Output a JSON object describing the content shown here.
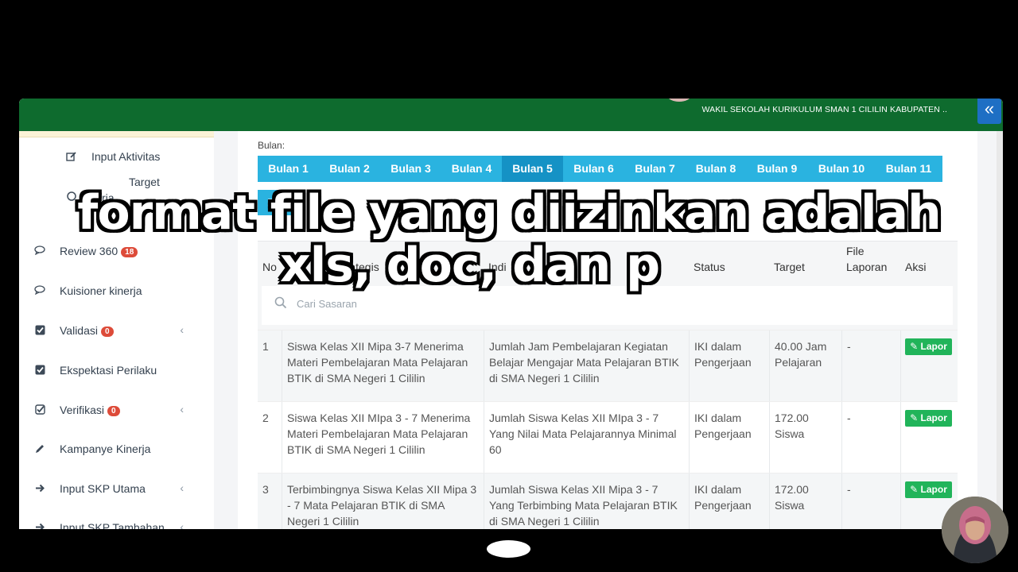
{
  "header": {
    "user": "WAKIL SEKOLAH KURIKULUM SMAN 1 CILILIN KABUPATEN ..",
    "collapse_icon": "double-chevron-left-icon"
  },
  "sidebar": {
    "items": [
      {
        "label": "Input Aktivitas",
        "icon": "edit-icon",
        "sub": true
      },
      {
        "label": "Target Kinerja",
        "icon": "circle-icon",
        "sub": true
      },
      {
        "label": "Review 360",
        "icon": "comment-icon",
        "badge": "18"
      },
      {
        "label": "Kuisioner kinerja",
        "icon": "comment-icon"
      },
      {
        "label": "Validasi",
        "icon": "check-square-icon",
        "badge": "0",
        "caret": true
      },
      {
        "label": "Ekspektasi Perilaku",
        "icon": "check-square-icon"
      },
      {
        "label": "Verifikasi",
        "icon": "check-square-outline-icon",
        "badge": "0",
        "caret": true
      },
      {
        "label": "Kampanye Kinerja",
        "icon": "pencil-icon"
      },
      {
        "label": "Input SKP Utama",
        "icon": "arrow-right-icon",
        "caret": true
      },
      {
        "label": "Input SKP Tambahan",
        "icon": "arrow-right-icon",
        "caret": true
      }
    ]
  },
  "content": {
    "month_label": "Bulan:",
    "tabs": [
      "Bulan 1",
      "Bulan 2",
      "Bulan 3",
      "Bulan 4",
      "Bulan 5",
      "Bulan 6",
      "Bulan 7",
      "Bulan 8",
      "Bulan 9",
      "Bulan 10",
      "Bulan 11",
      "Bu"
    ],
    "active_tab": "Bulan 5",
    "table": {
      "headers": [
        "No",
        "Kategis",
        "Indi",
        "Status",
        "Target",
        "File Laporan",
        "Aksi"
      ],
      "search_placeholder": "Cari Sasaran",
      "rows": [
        {
          "no": "1",
          "sasaran": "Siswa Kelas XII Mipa 3-7 Menerima Materi Pembelajaran Mata Pelajaran BTIK di SMA Negeri 1 Cililin",
          "indikator": "Jumlah Jam Pembelajaran Kegiatan Belajar Mengajar Mata Pelajaran BTIK di SMA Negeri 1 Cililin",
          "status": "IKI dalam Pengerjaan",
          "target": "40.00 Jam Pelajaran",
          "file": "-",
          "aksi": "Lapor"
        },
        {
          "no": "2",
          "sasaran": "Siswa Kelas XII MIpa 3 - 7 Menerima Materi Pembelajaran Mata Pelajaran BTIK di SMA Negeri 1 Cililin",
          "indikator": "Jumlah Siswa Kelas XII MIpa 3 - 7 Yang Nilai Mata Pelajarannya Minimal 60",
          "status": "IKI dalam Pengerjaan",
          "target": "172.00 Siswa",
          "file": "-",
          "aksi": "Lapor"
        },
        {
          "no": "3",
          "sasaran": "Terbimbingnya Siswa Kelas XII Mipa 3 - 7 Mata Pelajaran BTIK di SMA Negeri 1 Cililin",
          "indikator": "Jumlah Siswa Kelas XII Mipa 3 - 7 Yang Terbimbing Mata Pelajaran BTIK di SMA Negeri 1 Cililin",
          "status": "IKI dalam Pengerjaan",
          "target": "172.00 Siswa",
          "file": "-",
          "aksi": "Lapor"
        }
      ]
    }
  },
  "overlay": {
    "line1": "format file yang diizinkan adalah",
    "line2": "xls, doc, dan p"
  }
}
